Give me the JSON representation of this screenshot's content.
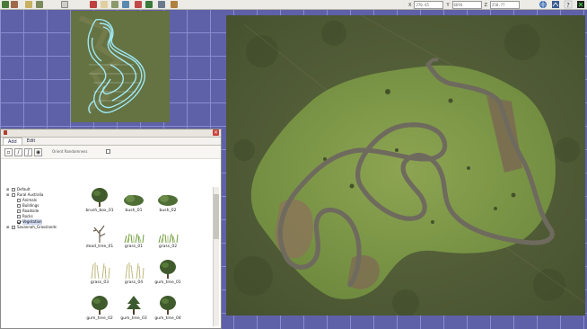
{
  "toolbar": {
    "coords": [
      {
        "label": "X",
        "value": "270.65"
      },
      {
        "label": "Y",
        "value": "6694"
      },
      {
        "label": "Z",
        "value": "250.77"
      }
    ]
  },
  "panel": {
    "tabs": [
      {
        "label": "Add"
      },
      {
        "label": "Edit"
      }
    ],
    "orient_label": "Orient Randomness",
    "tree": [
      {
        "label": "Default",
        "depth": 0,
        "checked": false,
        "selected": false
      },
      {
        "label": "Rural Australia",
        "depth": 0,
        "checked": false,
        "selected": false
      },
      {
        "label": "Animals",
        "depth": 1,
        "checked": false,
        "selected": false
      },
      {
        "label": "Buildings",
        "depth": 1,
        "checked": false,
        "selected": false
      },
      {
        "label": "Roadside",
        "depth": 1,
        "checked": false,
        "selected": false
      },
      {
        "label": "Rocks",
        "depth": 1,
        "checked": false,
        "selected": false
      },
      {
        "label": "Vegetation",
        "depth": 1,
        "checked": true,
        "selected": true
      },
      {
        "label": "Savannah_Grasslands",
        "depth": 0,
        "checked": false,
        "selected": false
      }
    ],
    "assets": [
      {
        "label": "brush_box_01",
        "kind": "tree"
      },
      {
        "label": "bush_01",
        "kind": "bush"
      },
      {
        "label": "bush_02",
        "kind": "bush"
      },
      {
        "label": "dead_tree_01",
        "kind": "dead"
      },
      {
        "label": "grass_01",
        "kind": "grass"
      },
      {
        "label": "grass_02",
        "kind": "grass"
      },
      {
        "label": "grass_03",
        "kind": "grass-tall"
      },
      {
        "label": "grass_04",
        "kind": "grass-tall"
      },
      {
        "label": "gum_tree_01",
        "kind": "tree"
      },
      {
        "label": "gum_tree_02",
        "kind": "tree"
      },
      {
        "label": "gum_tree_03",
        "kind": "pine"
      },
      {
        "label": "gum_tree_04",
        "kind": "tree"
      }
    ]
  }
}
